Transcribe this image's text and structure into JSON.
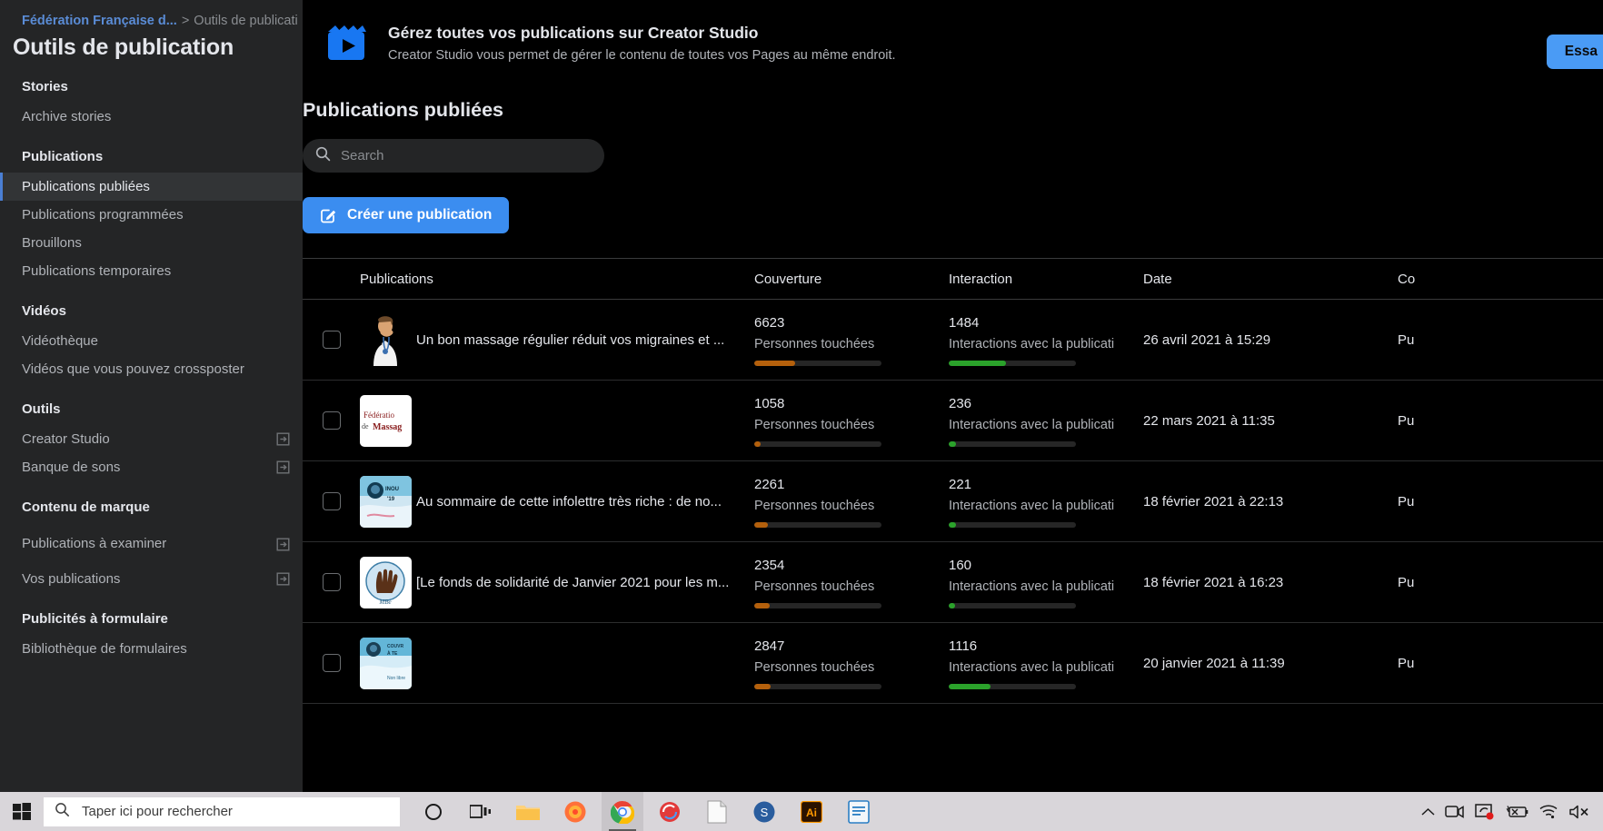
{
  "breadcrumb": {
    "page_link": "Fédération Française d...",
    "separator": ">",
    "current": "Outils de publicati"
  },
  "page_title": "Outils de publication",
  "sidebar": {
    "groups": [
      {
        "heading": "Stories",
        "items": [
          {
            "label": "Archive stories",
            "external": false,
            "active": false
          }
        ]
      },
      {
        "heading": "Publications",
        "items": [
          {
            "label": "Publications publiées",
            "external": false,
            "active": true
          },
          {
            "label": "Publications programmées",
            "external": false,
            "active": false
          },
          {
            "label": "Brouillons",
            "external": false,
            "active": false
          },
          {
            "label": "Publications temporaires",
            "external": false,
            "active": false
          }
        ]
      },
      {
        "heading": "Vidéos",
        "items": [
          {
            "label": "Vidéothèque",
            "external": false,
            "active": false
          },
          {
            "label": "Vidéos que vous pouvez crossposter",
            "external": false,
            "active": false
          }
        ]
      },
      {
        "heading": "Outils",
        "items": [
          {
            "label": "Creator Studio",
            "external": true,
            "active": false
          },
          {
            "label": "Banque de sons",
            "external": true,
            "active": false
          }
        ]
      },
      {
        "heading": "Contenu de marque",
        "items": [
          {
            "label": "Publications à examiner",
            "external": true,
            "active": false,
            "two_line": true
          },
          {
            "label": "Vos publications",
            "external": true,
            "active": false
          }
        ]
      },
      {
        "heading": "Publicités à formulaire",
        "items": [
          {
            "label": "Bibliothèque de formulaires",
            "external": false,
            "active": false
          }
        ]
      }
    ]
  },
  "banner": {
    "icon": "video-clapperboard-icon",
    "title": "Gérez toutes vos publications sur Creator Studio",
    "subtitle": "Creator Studio vous permet de gérer le contenu de toutes vos Pages au même endroit.",
    "cta_label": "Essa",
    "cta_color": "#4a9bf5"
  },
  "main": {
    "section_title": "Publications publiées",
    "search": {
      "placeholder": "Search",
      "value": "",
      "icon": "search-icon"
    },
    "create_button": {
      "label": "Créer une publication",
      "icon": "pencil-square-icon",
      "color": "#3b8df0"
    }
  },
  "table": {
    "columns": [
      "",
      "Publications",
      "Couverture",
      "Interaction",
      "Date",
      "Co"
    ],
    "metric_labels": {
      "coverage": "Personnes touchées",
      "interaction": "Interactions avec la publicati"
    },
    "bar_colors": {
      "coverage": "#b4600c",
      "interaction": "#2ba22b"
    },
    "rows": [
      {
        "thumb": "doctor-photo-thumb",
        "title": "Un bon massage régulier réduit vos migraines et ...",
        "coverage": "6623",
        "coverage_pct": 32,
        "interaction": "1484",
        "interaction_pct": 45,
        "date": "26 avril 2021 à 15:29",
        "status": "Pu"
      },
      {
        "thumb": "federation-logo-thumb",
        "title": "",
        "coverage": "1058",
        "coverage_pct": 5,
        "interaction": "236",
        "interaction_pct": 6,
        "date": "22 mars 2021 à 11:35",
        "status": "Pu"
      },
      {
        "thumb": "infolettre-thumb",
        "title": "Au sommaire de cette infolettre très riche : de no...",
        "coverage": "2261",
        "coverage_pct": 11,
        "interaction": "221",
        "interaction_pct": 6,
        "date": "18 février 2021 à 22:13",
        "status": "Pu"
      },
      {
        "thumb": "hand-logo-thumb",
        "title": "[Le fonds de solidarité de Janvier 2021 pour les m...",
        "coverage": "2354",
        "coverage_pct": 12,
        "interaction": "160",
        "interaction_pct": 5,
        "date": "18 février 2021 à 16:23",
        "status": "Pu"
      },
      {
        "thumb": "blue-poster-thumb",
        "title": "",
        "coverage": "2847",
        "coverage_pct": 13,
        "interaction": "1116",
        "interaction_pct": 33,
        "date": "20 janvier 2021 à 11:39",
        "status": "Pu"
      }
    ]
  },
  "taskbar": {
    "start_icon": "windows-start-icon",
    "search_placeholder": "Taper ici pour rechercher",
    "search_icon": "search-icon",
    "apps": [
      {
        "name": "cortana-icon"
      },
      {
        "name": "task-view-icon"
      },
      {
        "name": "file-explorer-icon",
        "active": false
      },
      {
        "name": "firefox-icon",
        "active": false
      },
      {
        "name": "chrome-icon",
        "active": true
      },
      {
        "name": "sync-app-icon",
        "active": false
      },
      {
        "name": "notepad-icon",
        "active": false
      },
      {
        "name": "skype-icon",
        "active": false
      },
      {
        "name": "illustrator-icon",
        "active": false
      },
      {
        "name": "libreoffice-writer-icon",
        "active": false
      }
    ],
    "tray": [
      {
        "name": "show-hidden-icons-chevron"
      },
      {
        "name": "camera-icon"
      },
      {
        "name": "screen-share-icon"
      },
      {
        "name": "battery-unavailable-icon"
      },
      {
        "name": "wifi-icon"
      },
      {
        "name": "volume-muted-icon"
      }
    ]
  }
}
